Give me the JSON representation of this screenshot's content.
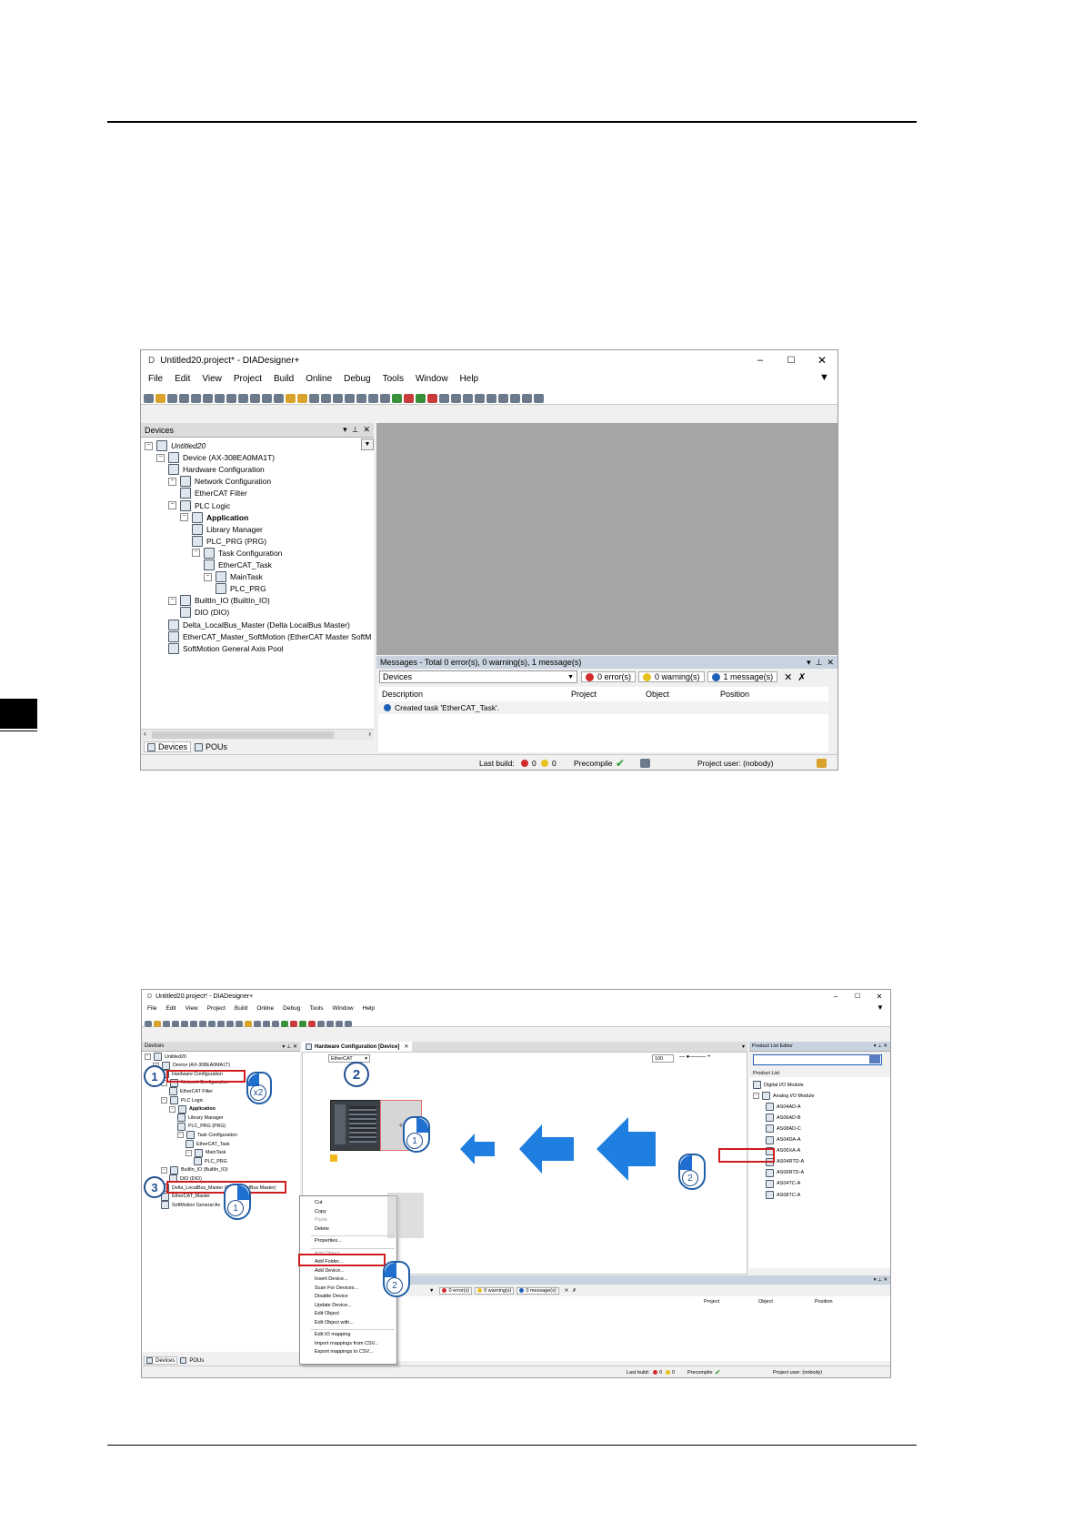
{
  "screenshot1": {
    "title": "Untitled20.project* - DIADesigner+",
    "menu": [
      "File",
      "Edit",
      "View",
      "Project",
      "Build",
      "Online",
      "Debug",
      "Tools",
      "Window",
      "Help"
    ],
    "devices_panel": {
      "header": "Devices",
      "tree": [
        {
          "text": "Untitled20",
          "indent": 0,
          "italic": true
        },
        {
          "text": "Device (AX-308EA0MA1T)",
          "indent": 1
        },
        {
          "text": "Hardware Configuration",
          "indent": 2
        },
        {
          "text": "Network Configuration",
          "indent": 2
        },
        {
          "text": "EtherCAT Filter",
          "indent": 3
        },
        {
          "text": "PLC Logic",
          "indent": 2
        },
        {
          "text": "Application",
          "indent": 3,
          "bold": true
        },
        {
          "text": "Library Manager",
          "indent": 4
        },
        {
          "text": "PLC_PRG (PRG)",
          "indent": 4
        },
        {
          "text": "Task Configuration",
          "indent": 4
        },
        {
          "text": "EtherCAT_Task",
          "indent": 5
        },
        {
          "text": "MainTask",
          "indent": 5
        },
        {
          "text": "PLC_PRG",
          "indent": 6
        },
        {
          "text": "BuiltIn_IO (BuiltIn_IO)",
          "indent": 2
        },
        {
          "text": "DIO (DIO)",
          "indent": 3
        },
        {
          "text": "Delta_LocalBus_Master (Delta LocalBus Master)",
          "indent": 2
        },
        {
          "text": "EtherCAT_Master_SoftMotion (EtherCAT Master SoftM",
          "indent": 2
        },
        {
          "text": "SoftMotion General Axis Pool",
          "indent": 2
        }
      ],
      "tabs": [
        "Devices",
        "POUs"
      ]
    },
    "messages": {
      "header": "Messages - Total 0 error(s), 0 warning(s), 1 message(s)",
      "filter": "Devices",
      "errors": "0 error(s)",
      "warnings": "0 warning(s)",
      "messages": "1 message(s)",
      "columns": [
        "Description",
        "Project",
        "Object",
        "Position"
      ],
      "row": "Created task 'EtherCAT_Task'."
    },
    "status": {
      "last_build": "Last build:",
      "err": "0",
      "warn": "0",
      "precompile": "Precompile",
      "user": "Project user: (nobody)"
    }
  },
  "screenshot2": {
    "title": "Untitled20.project* - DIADesigner+",
    "menu": [
      "File",
      "Edit",
      "View",
      "Project",
      "Build",
      "Online",
      "Debug",
      "Tools",
      "Window",
      "Help"
    ],
    "devices_header": "Devices",
    "tree": [
      {
        "text": "Untitled20",
        "indent": 0
      },
      {
        "text": "Device (AX-308EA0MA1T)",
        "indent": 1
      },
      {
        "text": "Hardware Configuration",
        "indent": 2
      },
      {
        "text": "Network Configuration",
        "indent": 2
      },
      {
        "text": "EtherCAT Filter",
        "indent": 3
      },
      {
        "text": "PLC Logic",
        "indent": 2
      },
      {
        "text": "Application",
        "indent": 3,
        "bold": true
      },
      {
        "text": "Library Manager",
        "indent": 4
      },
      {
        "text": "PLC_PRG (PRG)",
        "indent": 4
      },
      {
        "text": "Task Configuration",
        "indent": 4
      },
      {
        "text": "EtherCAT_Task",
        "indent": 5
      },
      {
        "text": "MainTask",
        "indent": 5
      },
      {
        "text": "PLC_PRG",
        "indent": 6
      },
      {
        "text": "BuiltIn_IO (BuiltIn_IO)",
        "indent": 2
      },
      {
        "text": "DIO (DIO)",
        "indent": 3
      },
      {
        "text": "Delta_LocalBus_Master (Delta LocalBus Master)",
        "indent": 2
      },
      {
        "text": "EtherCAT_Master",
        "indent": 2
      },
      {
        "text": "SoftMotion General Ax",
        "indent": 2
      }
    ],
    "editor_tab": "Hardware Configuration [Device]",
    "editor_combo": "EtherCAT",
    "zoom": "100",
    "product_list_editor": "Product List Editor",
    "product_list": "Product List",
    "product_tree": [
      {
        "text": "Digital I/O Module",
        "indent": 0
      },
      {
        "text": "Analog I/O Module",
        "indent": 0
      },
      {
        "text": "AS04AD-A",
        "indent": 1
      },
      {
        "text": "AS06AD-B",
        "indent": 1
      },
      {
        "text": "AS08AD-C",
        "indent": 1
      },
      {
        "text": "AS04DA-A",
        "indent": 1
      },
      {
        "text": "AS06XA-A",
        "indent": 1
      },
      {
        "text": "AS04RTD-A",
        "indent": 1
      },
      {
        "text": "AS06RTD-A",
        "indent": 1
      },
      {
        "text": "AS04TC-A",
        "indent": 1
      },
      {
        "text": "AS08TC-A",
        "indent": 1
      }
    ],
    "context_menu": [
      {
        "text": "Cut",
        "disabled": false
      },
      {
        "text": "Copy",
        "disabled": false
      },
      {
        "text": "Paste",
        "disabled": true
      },
      {
        "text": "Delete",
        "disabled": false
      },
      {
        "sep": true
      },
      {
        "text": "Properties...",
        "disabled": false
      },
      {
        "sep": true
      },
      {
        "text": "Add Object",
        "disabled": true
      },
      {
        "text": "Add Folder...",
        "disabled": false
      },
      {
        "text": "Add Device...",
        "disabled": false
      },
      {
        "text": "Insert Device...",
        "disabled": false
      },
      {
        "text": "Scan For Devices...",
        "disabled": false
      },
      {
        "text": "Disable Device",
        "disabled": false
      },
      {
        "text": "Update Device...",
        "disabled": false
      },
      {
        "text": "Edit Object",
        "disabled": false
      },
      {
        "text": "Edit Object with...",
        "disabled": false
      },
      {
        "sep": true
      },
      {
        "text": "Edit IO mapping",
        "disabled": false
      },
      {
        "text": "Import mappings from CSV...",
        "disabled": false
      },
      {
        "text": "Export mappings to CSV...",
        "disabled": false
      }
    ],
    "messages": {
      "errors": "0 error(s)",
      "warnings": "0 warning(s)",
      "messages": "0 message(s)",
      "columns": [
        "Project",
        "Object",
        "Position"
      ]
    },
    "tabs": [
      "Devices",
      "POUs"
    ],
    "status": {
      "last_build": "Last build:",
      "err": "0",
      "warn": "0",
      "precompile": "Precompile",
      "user": "Project user: (nobody)"
    },
    "callouts": [
      "1",
      "2",
      "3"
    ],
    "mouse_labels": [
      "1",
      "2",
      "x2"
    ]
  },
  "colors": {
    "highlight": "#d01c1c",
    "callout": "#1f4f8f",
    "arrow": "#1f7fe0",
    "gray_editor": "#a5a5a5"
  }
}
